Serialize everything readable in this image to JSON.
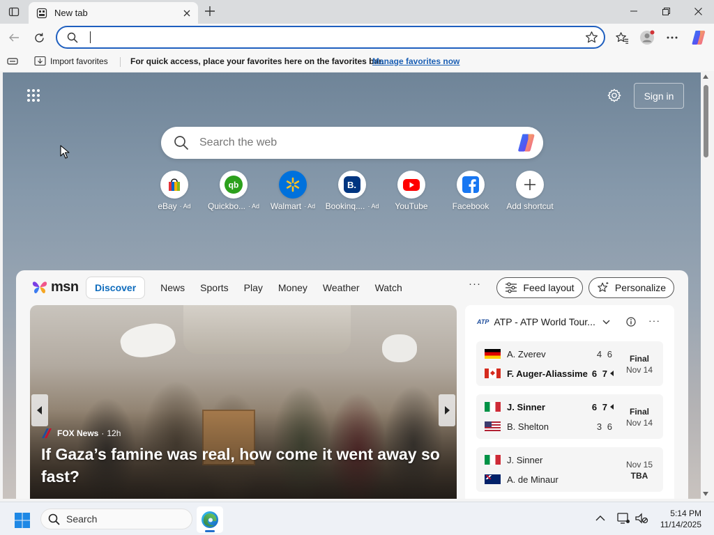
{
  "browser": {
    "tab_title": "New tab",
    "address_value": "",
    "favorites_bar": {
      "import_label": "Import favorites",
      "message": "For quick access, place your favorites here on the favorites bar.",
      "link": "Manage favorites now"
    }
  },
  "newtab": {
    "sign_in": "Sign in",
    "search_placeholder": "Search the web",
    "shortcuts": [
      {
        "label": "eBay",
        "ad": "Ad",
        "icon": "ebay-icon"
      },
      {
        "label": "Quickbo...",
        "ad": "Ad",
        "icon": "quickbooks-icon"
      },
      {
        "label": "Walmart",
        "ad": "Ad",
        "icon": "walmart-icon"
      },
      {
        "label": "Bookinq....",
        "ad": "Ad",
        "icon": "booking-icon"
      },
      {
        "label": "YouTube",
        "ad": "",
        "icon": "youtube-icon"
      },
      {
        "label": "Facebook",
        "ad": "",
        "icon": "facebook-icon"
      },
      {
        "label": "Add shortcut",
        "ad": "",
        "icon": "plus-icon"
      }
    ]
  },
  "feed": {
    "logo_text": "msn",
    "nav": [
      "Discover",
      "News",
      "Sports",
      "Play",
      "Money",
      "Weather",
      "Watch"
    ],
    "more": "···",
    "feed_layout": "Feed layout",
    "personalize": "Personalize",
    "hero": {
      "source": "FOX News",
      "age": "12h",
      "headline": "If Gaza’s famine was real, how come it went away so fast?"
    },
    "sports": {
      "title": "ATP - ATP World Tour...",
      "logo_text": "ATP",
      "matches": [
        {
          "p1": "A. Zverev",
          "p1_flag": "de",
          "p1_score": "4 6",
          "p1_win": false,
          "p1_serve": false,
          "p2": "F. Auger-Aliassime",
          "p2_flag": "ca",
          "p2_score": "6 7",
          "p2_win": true,
          "p2_serve": true,
          "status": "Final",
          "date": "Nov 14"
        },
        {
          "p1": "J. Sinner",
          "p1_flag": "it",
          "p1_score": "6 7",
          "p1_win": true,
          "p1_serve": true,
          "p2": "B. Shelton",
          "p2_flag": "us",
          "p2_score": "3 6",
          "p2_win": false,
          "p2_serve": false,
          "status": "Final",
          "date": "Nov 14"
        },
        {
          "p1": "J. Sinner",
          "p1_flag": "it",
          "p1_score": "",
          "p1_win": false,
          "p1_serve": false,
          "p2": "A. de Minaur",
          "p2_flag": "au",
          "p2_score": "",
          "p2_win": false,
          "p2_serve": false,
          "status": "TBA",
          "date": "Nov 15"
        }
      ]
    }
  },
  "taskbar": {
    "search": "Search",
    "time": "5:14 PM",
    "date": "11/14/2025"
  },
  "colors": {
    "accent": "#1f5fbf",
    "link": "#1a5fb4",
    "msn_active": "#0f6cbd"
  }
}
